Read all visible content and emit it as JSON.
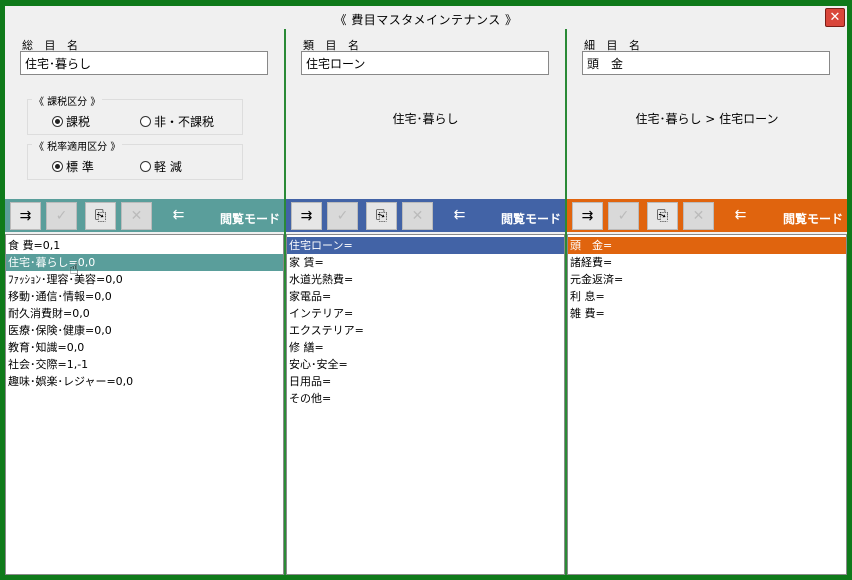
{
  "window": {
    "title": "《 費目マスタメインテナンス 》"
  },
  "col1": {
    "label": "総 目 名",
    "value": "住宅･暮らし",
    "tax_group": {
      "title": "《 課税区分 》",
      "opt1": "課税",
      "opt2": "非・不課税",
      "selected": "opt1"
    },
    "rate_group": {
      "title": "《 税率適用区分 》",
      "opt1": "標 準",
      "opt2": "軽 減",
      "selected": "opt1"
    },
    "mode": "閲覧モード",
    "color": "#5a9e9b",
    "rows": [
      "食 費=0,1",
      "住宅･暮らし=0,0",
      "ﾌｧｯｼｮﾝ･理容･美容=0,0",
      "移動･通信･情報=0,0",
      "耐久消費財=0,0",
      "医療･保険･健康=0,0",
      "教育･知識=0,0",
      "社会･交際=1,-1",
      "趣味･娯楽･レジャー=0,0"
    ],
    "selected_index": 1
  },
  "col2": {
    "label": "類 目 名",
    "value": "住宅ローン",
    "crumb": "住宅･暮らし",
    "mode": "閲覧モード",
    "color": "#4263a6",
    "rows": [
      "住宅ローン=",
      "家 賃=",
      "水道光熱費=",
      "家電品=",
      "インテリア=",
      "エクステリア=",
      "修 繕=",
      "安心･安全=",
      "日用品=",
      "その他="
    ],
    "selected_index": 0
  },
  "col3": {
    "label": "細 目 名",
    "value": "頭　金",
    "crumb": "住宅･暮らし > 住宅ローン",
    "mode": "閲覧モード",
    "color": "#e0640e",
    "rows": [
      "頭　金=",
      "諸経費=",
      "元金返済=",
      "利 息=",
      "雑 費="
    ],
    "selected_index": 0
  },
  "icons": {
    "add": "insert-row-icon",
    "check": "check-icon",
    "copy": "copy-icon",
    "delete": "delete-icon",
    "remove": "remove-row-icon"
  }
}
